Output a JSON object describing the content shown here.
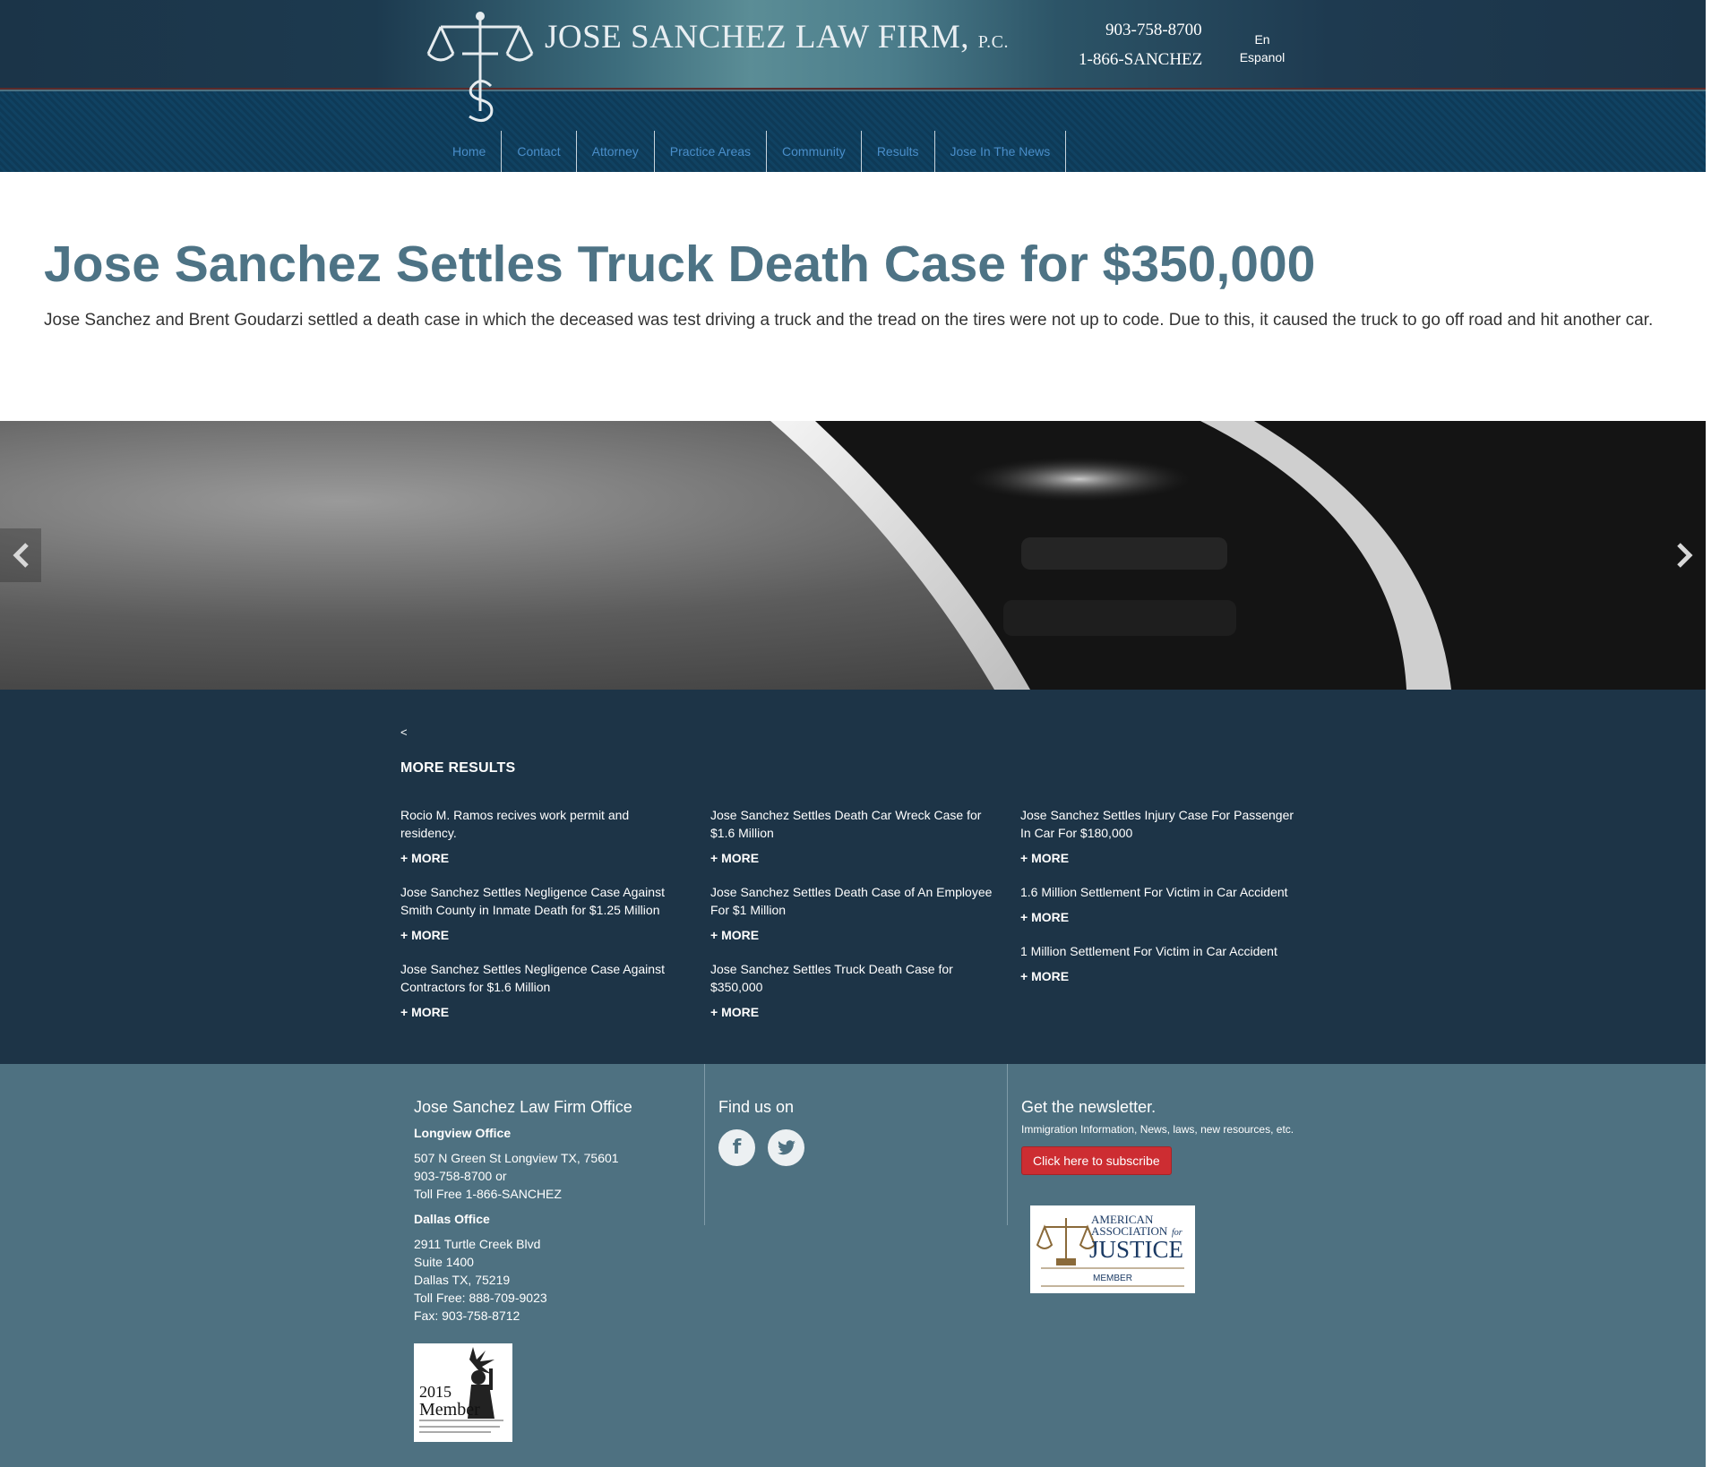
{
  "header": {
    "firm_name": "JOSE SANCHEZ LAW FIRM,",
    "firm_suffix": "P.C.",
    "phone_local": "903-758-8700",
    "phone_tollfree": "1-866-SANCHEZ",
    "languages": [
      "En",
      "Espanol"
    ]
  },
  "nav": {
    "items": [
      "Home",
      "Contact",
      "Attorney",
      "Practice Areas",
      "Community",
      "Results",
      "Jose In The News"
    ]
  },
  "article": {
    "title": "Jose Sanchez Settles Truck Death Case for $350,000",
    "description": "Jose Sanchez and Brent Goudarzi settled a death case in which the deceased was test driving a truck and the tread on the tires were not up to code. Due to this, it caused the truck to go off road and hit another car."
  },
  "results": {
    "back": "<",
    "heading": "MORE RESULTS",
    "more_label": "+ MORE",
    "columns": [
      [
        "Rocio M. Ramos recives work permit and residency.",
        "Jose Sanchez Settles Negligence Case Against Smith County in Inmate Death for $1.25 Million",
        "Jose Sanchez Settles Negligence Case Against Contractors for $1.6 Million"
      ],
      [
        "Jose Sanchez Settles Death Car Wreck Case for $1.6 Million",
        "Jose Sanchez Settles Death Case of An Employee For $1 Million",
        "Jose Sanchez Settles Truck Death Case for $350,000"
      ],
      [
        "Jose Sanchez Settles Injury Case For Passenger In Car For $180,000",
        "1.6 Million Settlement For Victim in Car Accident",
        "1 Million Settlement For Victim in Car Accident"
      ]
    ]
  },
  "footer": {
    "office": {
      "heading": "Jose Sanchez Law Firm Office",
      "longview_title": "Longview Office",
      "longview_lines": [
        "507 N Green St Longview TX, 75601",
        "903-758-8700 or",
        "Toll Free 1-866-SANCHEZ"
      ],
      "dallas_title": "Dallas Office",
      "dallas_lines": [
        "2911 Turtle Creek Blvd",
        "Suite 1400",
        "Dallas TX, 75219",
        "Toll Free: 888-709-9023",
        "Fax: 903-758-8712"
      ]
    },
    "social": {
      "heading": "Find us on",
      "facebook_glyph": "f",
      "twitter_glyph": "t"
    },
    "newsletter": {
      "heading": "Get the newsletter.",
      "text": "Immigration Information, News, laws, new resources, etc.",
      "button": "Click here to subscribe"
    },
    "badges": {
      "aaj_line1": "AMERICAN",
      "aaj_line2": "ASSOCIATION",
      "aaj_for": "for",
      "aaj_line3": "JUSTICE",
      "aaj_member": "MEMBER",
      "member_year": "2015",
      "member_word": "Member"
    }
  },
  "colors": {
    "nav_link": "#4a8ec9",
    "title": "#4d7385",
    "results_bg": "#1d3447",
    "footer_bg": "#4e7181",
    "subscribe": "#cd2d32"
  }
}
